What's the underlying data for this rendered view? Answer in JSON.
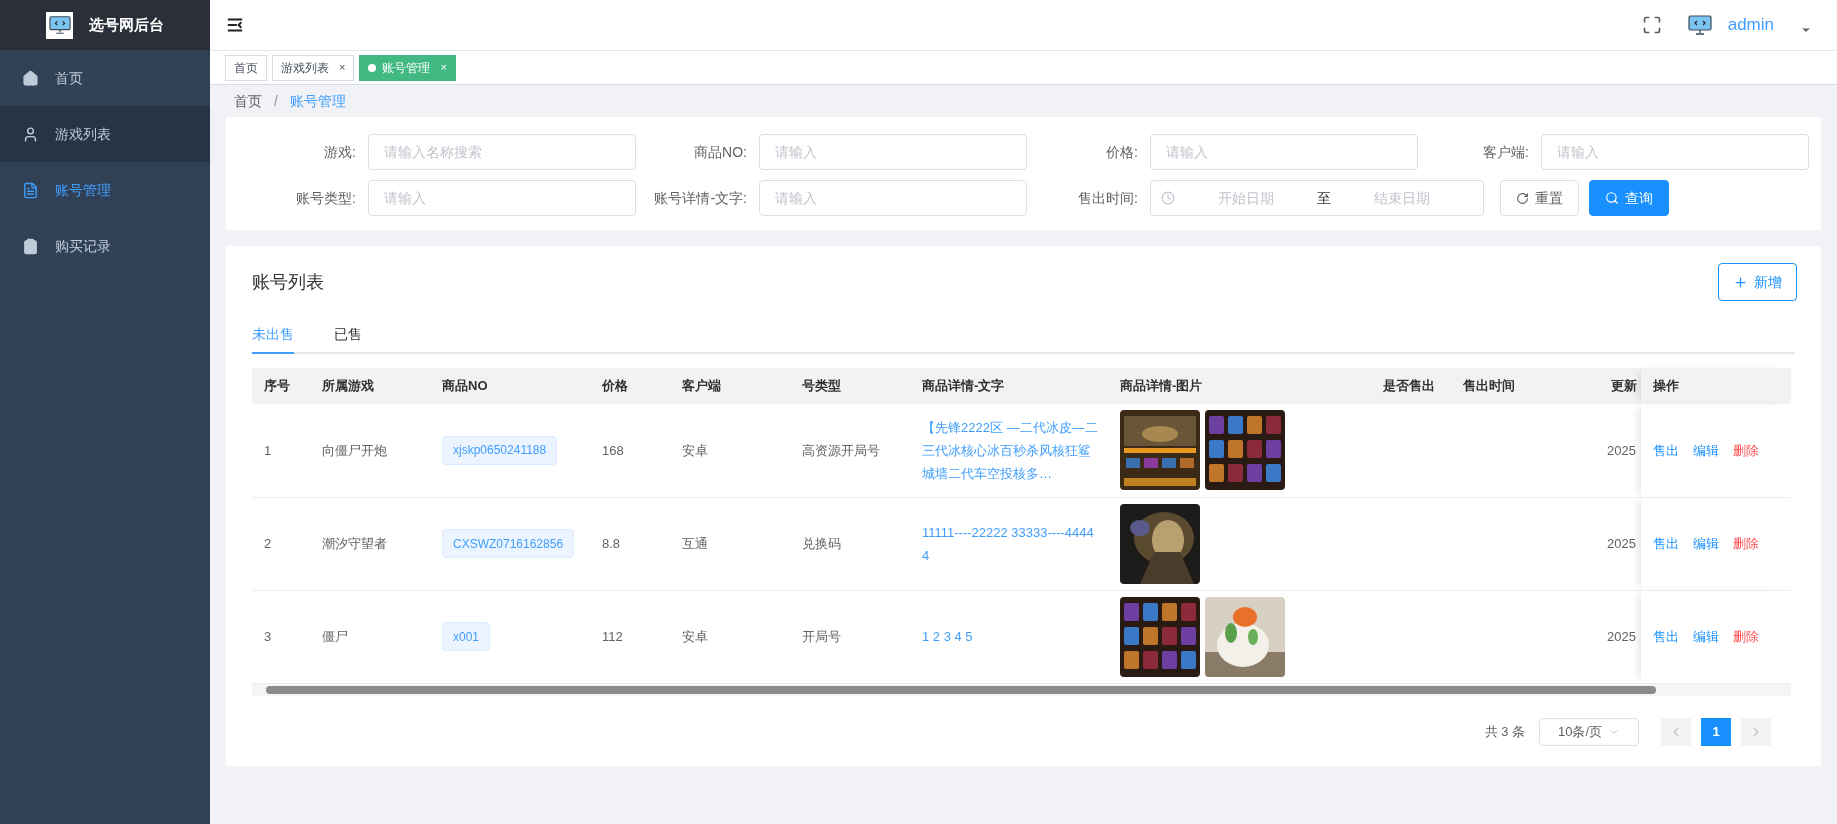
{
  "app": {
    "title": "选号网后台"
  },
  "sidebar": {
    "items": [
      {
        "label": "首页",
        "kind": "home",
        "selected": false,
        "highlighted": false
      },
      {
        "label": "游戏列表",
        "kind": "user",
        "selected": false,
        "highlighted": true
      },
      {
        "label": "账号管理",
        "kind": "document",
        "selected": true,
        "highlighted": false
      },
      {
        "label": "购买记录",
        "kind": "clipboard",
        "selected": false,
        "highlighted": false
      }
    ]
  },
  "header": {
    "user": "admin"
  },
  "tags": [
    {
      "label": "首页",
      "closable": false,
      "selected": false
    },
    {
      "label": "游戏列表",
      "closable": true,
      "selected": false
    },
    {
      "label": "账号管理",
      "closable": true,
      "selected": true
    }
  ],
  "tag_close": "×",
  "breadcrumb": [
    {
      "label": "首页",
      "selected": false
    },
    {
      "label": "账号管理",
      "selected": true
    }
  ],
  "breadcrumb_separator": "/",
  "filters": [
    {
      "kind": "input",
      "label": "游戏:",
      "placeholder": "请输入名称搜索"
    },
    {
      "kind": "input",
      "label": "商品NO:",
      "placeholder": "请输入"
    },
    {
      "kind": "input",
      "label": "价格:",
      "placeholder": "请输入"
    },
    {
      "kind": "input",
      "label": "客户端:",
      "placeholder": "请输入"
    },
    {
      "kind": "input",
      "label": "账号类型:",
      "placeholder": "请输入"
    },
    {
      "kind": "input",
      "label": "账号详情-文字:",
      "placeholder": "请输入"
    },
    {
      "kind": "daterange",
      "label": "售出时间:",
      "start_placeholder": "开始日期",
      "separator": "至",
      "end_placeholder": "结束日期"
    }
  ],
  "filter_buttons": [
    {
      "kind": "reset",
      "label": "重置"
    },
    {
      "kind": "search",
      "label": "查询"
    }
  ],
  "list": {
    "title": "账号列表",
    "add_button": "新增",
    "tabs": [
      {
        "label": "未出售",
        "selected": true
      },
      {
        "label": "已售",
        "selected": false
      }
    ],
    "columns": [
      "序号",
      "所属游戏",
      "商品NO",
      "价格",
      "客户端",
      "号类型",
      "商品详情-文字",
      "商品详情-图片",
      "是否售出",
      "售出时间",
      "更新",
      "操作"
    ],
    "rows": [
      {
        "index": "1",
        "game": "向僵尸开炮",
        "product_no": "xjskp0650241188",
        "price": "168",
        "client": "安卓",
        "type": "高资源开局号",
        "detail_text": "【先锋2222区 —二代冰皮—二三代冰核心冰百秒杀风核狂鲨城墙二代车空投核多…",
        "images": [
          {
            "kind": "picture"
          },
          {
            "kind": "picture"
          }
        ],
        "updated": "2025",
        "actions": [
          {
            "label": "售出",
            "kind": "normal"
          },
          {
            "label": "编辑",
            "kind": "normal"
          },
          {
            "label": "删除",
            "kind": "danger"
          }
        ]
      },
      {
        "index": "2",
        "game": "潮汐守望者",
        "product_no": "CXSWZ0716162856",
        "price": "8.8",
        "client": "互通",
        "type": "兑换码",
        "detail_text": "11111----22222 33333----44444",
        "images": [
          {
            "kind": "picture"
          }
        ],
        "updated": "2025",
        "actions": [
          {
            "label": "售出",
            "kind": "normal"
          },
          {
            "label": "编辑",
            "kind": "normal"
          },
          {
            "label": "删除",
            "kind": "danger"
          }
        ]
      },
      {
        "index": "3",
        "game": "僵尸",
        "product_no": "x001",
        "price": "112",
        "client": "安卓",
        "type": "开局号",
        "detail_text": "1 2 3 4 5",
        "images": [
          {
            "kind": "picture"
          },
          {
            "kind": "picture"
          }
        ],
        "updated": "2025",
        "actions": [
          {
            "label": "售出",
            "kind": "normal"
          },
          {
            "label": "编辑",
            "kind": "normal"
          },
          {
            "label": "删除",
            "kind": "danger"
          }
        ]
      }
    ]
  },
  "pagination": {
    "total": "共 3 条",
    "page_size": "10条/页",
    "pages": [
      {
        "label": "1",
        "selected": true
      }
    ]
  }
}
